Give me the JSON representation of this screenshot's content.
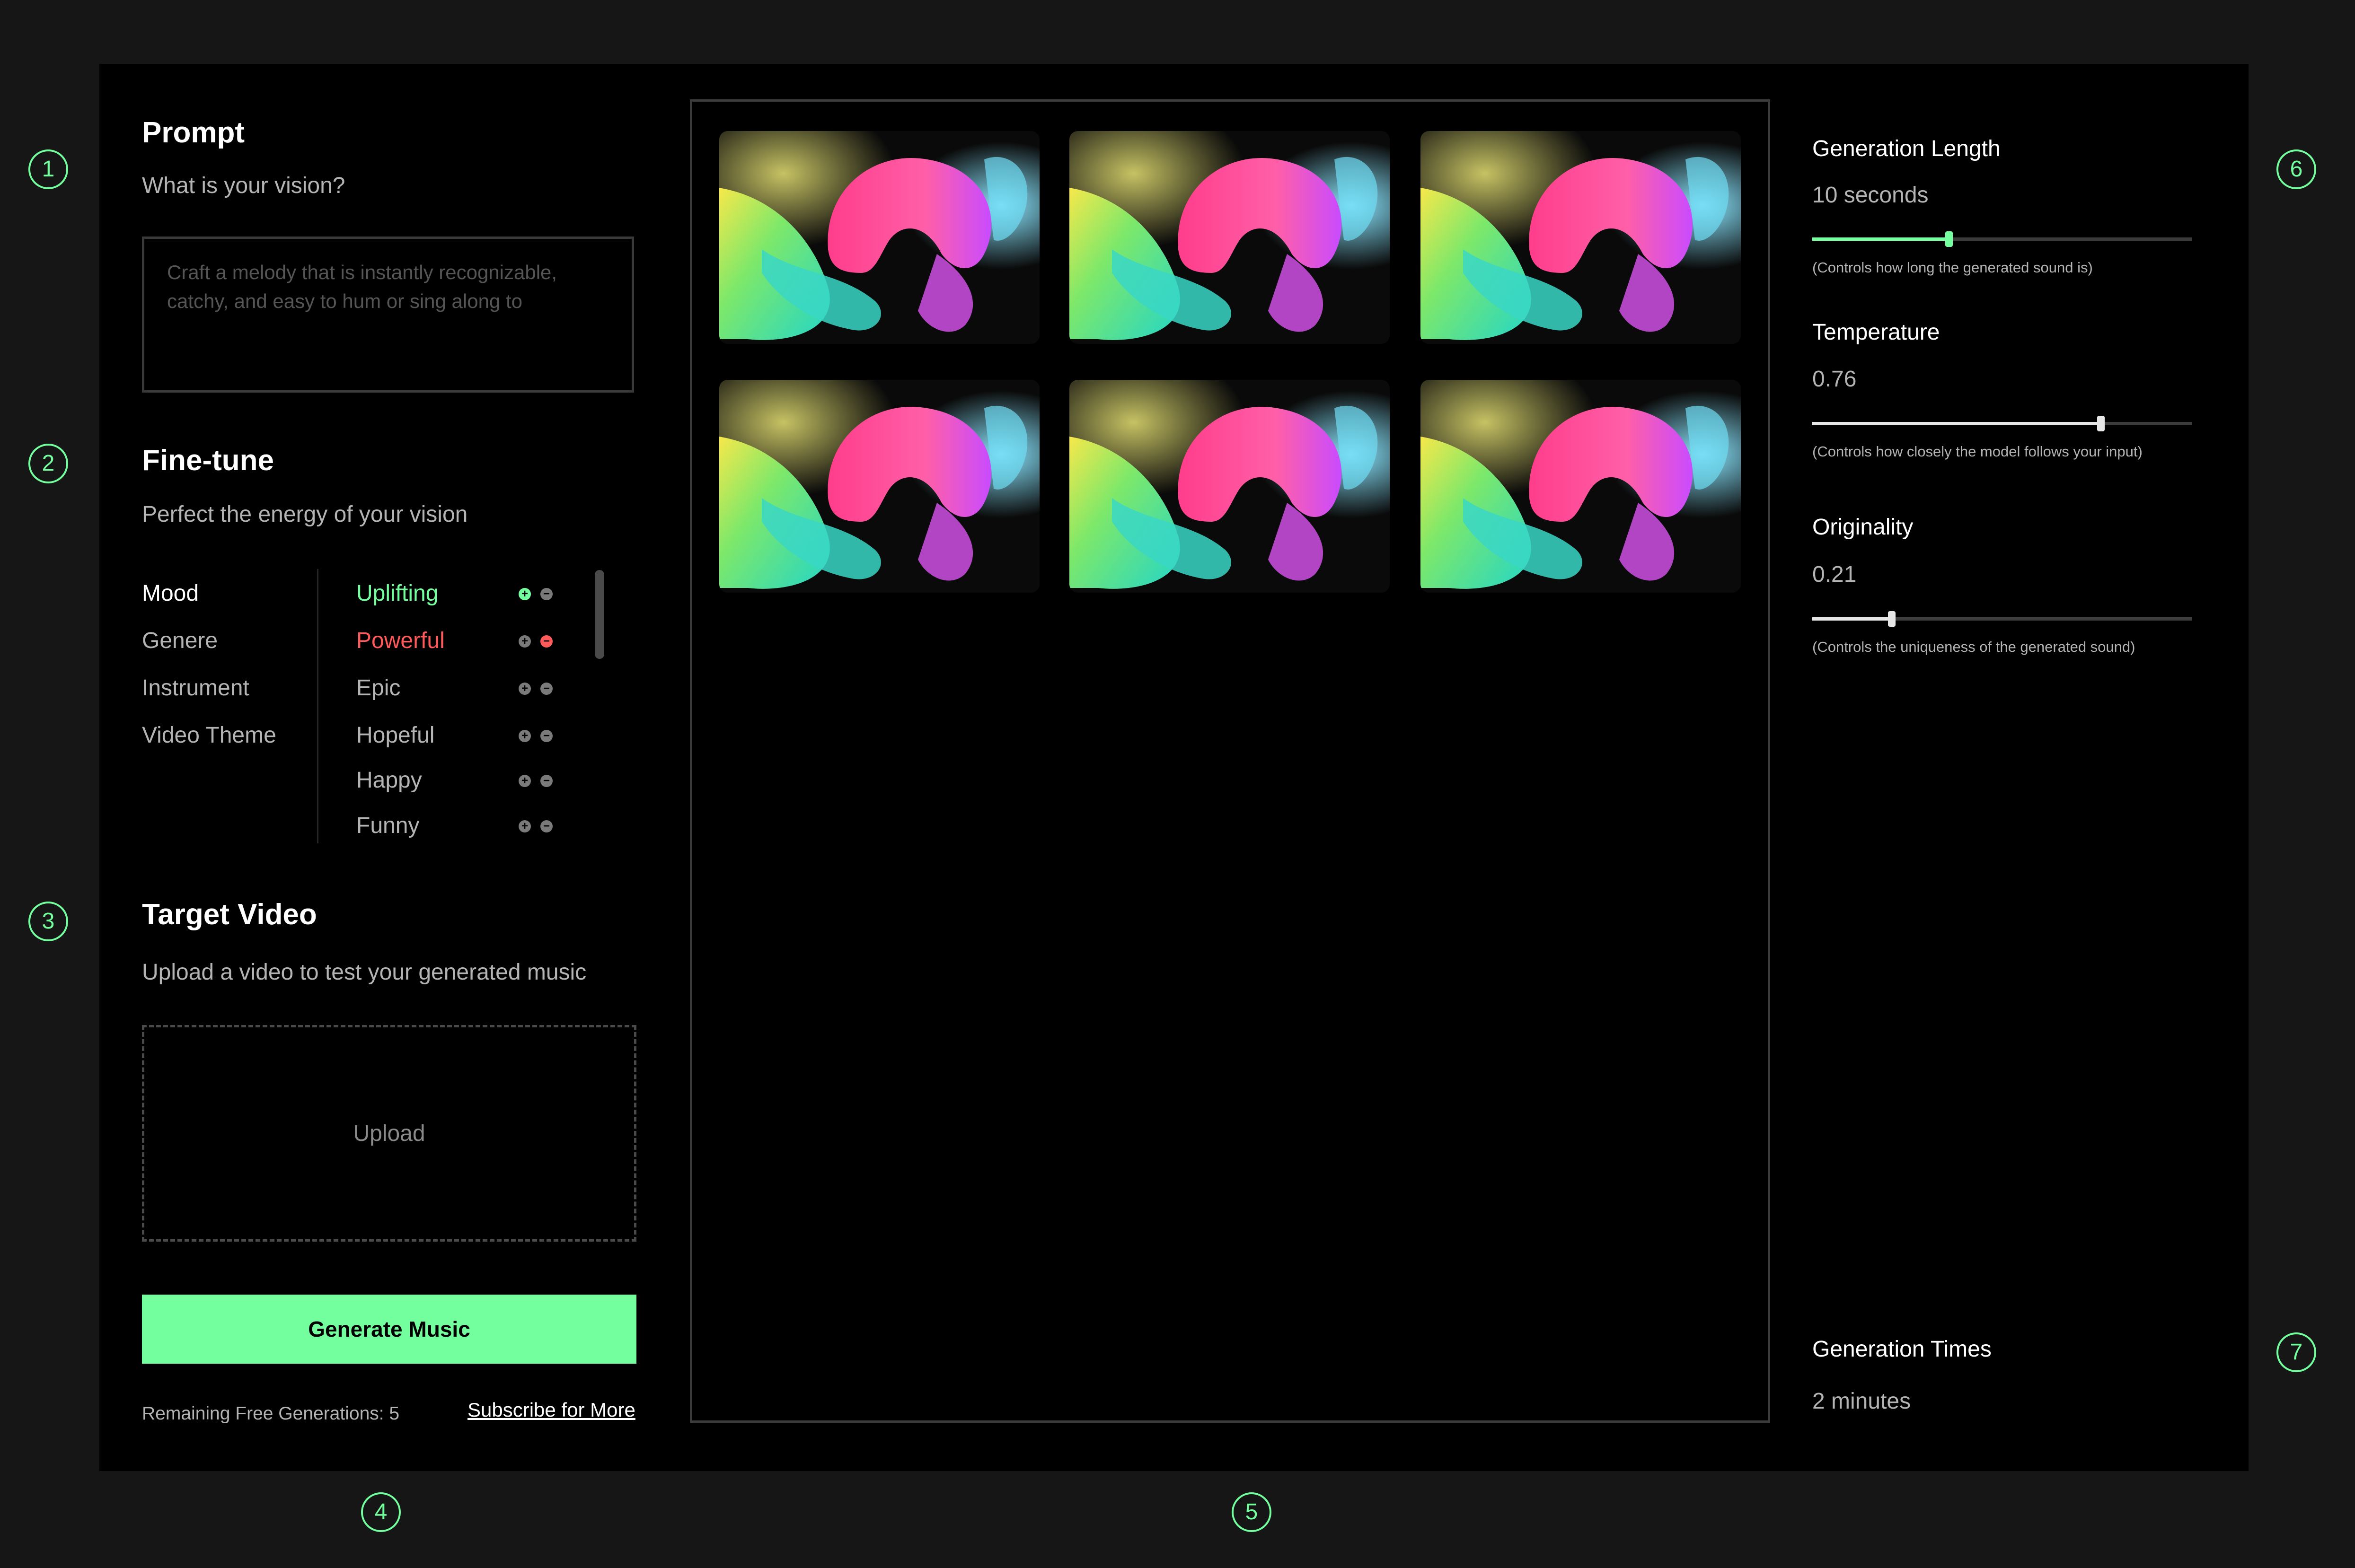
{
  "markers": [
    "1",
    "2",
    "3",
    "4",
    "5",
    "6",
    "7"
  ],
  "prompt": {
    "title": "Prompt",
    "subtitle": "What is your vision?",
    "placeholder": "Craft a melody that is instantly recognizable, catchy, and easy to hum or sing along to",
    "value": ""
  },
  "finetune": {
    "title": "Fine-tune",
    "subtitle": "Perfect the energy of your vision",
    "categories": [
      "Mood",
      "Genere",
      "Instrument",
      "Video Theme"
    ],
    "active_category": "Mood",
    "tags": [
      {
        "label": "Uplifting",
        "state": "included"
      },
      {
        "label": "Powerful",
        "state": "excluded"
      },
      {
        "label": "Epic",
        "state": "neutral"
      },
      {
        "label": "Hopeful",
        "state": "neutral"
      },
      {
        "label": "Happy",
        "state": "neutral"
      },
      {
        "label": "Funny",
        "state": "neutral"
      }
    ]
  },
  "target_video": {
    "title": "Target Video",
    "subtitle": "Upload a video to test your generated music",
    "upload_label": "Upload"
  },
  "actions": {
    "generate_label": "Generate Music",
    "remaining_label": "Remaining Free Generations: 5",
    "subscribe_label": "Subscribe for More"
  },
  "results": {
    "thumbnail_count": 6
  },
  "settings": {
    "generation_length": {
      "label": "Generation Length",
      "value": "10 seconds",
      "note": "(Controls how long the generated sound is)",
      "level": 0.36
    },
    "temperature": {
      "label": "Temperature",
      "value": "0.76",
      "note": "(Controls how closely the model follows your input)",
      "level": 0.76
    },
    "originality": {
      "label": "Originality",
      "value": "0.21",
      "note": "(Controls the uniqueness of the generated sound)",
      "level": 0.21
    },
    "generation_times": {
      "label": "Generation Times",
      "value": "2 minutes"
    }
  },
  "colors": {
    "accent": "#73ff9d",
    "negative": "#ff5a5a",
    "panel": "#000000",
    "background": "#161616"
  }
}
